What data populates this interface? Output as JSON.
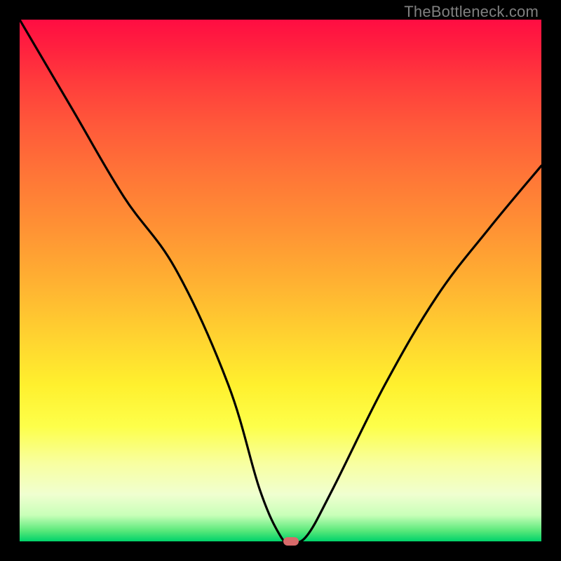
{
  "watermark": "TheBottleneck.com",
  "chart_data": {
    "type": "line",
    "title": "",
    "xlabel": "",
    "ylabel": "",
    "xlim": [
      0,
      100
    ],
    "ylim": [
      0,
      100
    ],
    "series": [
      {
        "name": "bottleneck-curve",
        "x": [
          0,
          10,
          20,
          30,
          40,
          46,
          50,
          52,
          55,
          60,
          70,
          80,
          90,
          100
        ],
        "values": [
          100,
          83,
          66,
          52,
          30,
          10,
          1,
          0,
          1,
          10,
          30,
          47,
          60,
          72
        ]
      }
    ],
    "marker": {
      "x": 52,
      "y": 0,
      "color": "#d86a6a"
    },
    "gradient_stops": [
      {
        "pos": 0,
        "color": "#ff0d42"
      },
      {
        "pos": 50,
        "color": "#ffb032"
      },
      {
        "pos": 78,
        "color": "#fdff4a"
      },
      {
        "pos": 100,
        "color": "#00d26a"
      }
    ]
  }
}
